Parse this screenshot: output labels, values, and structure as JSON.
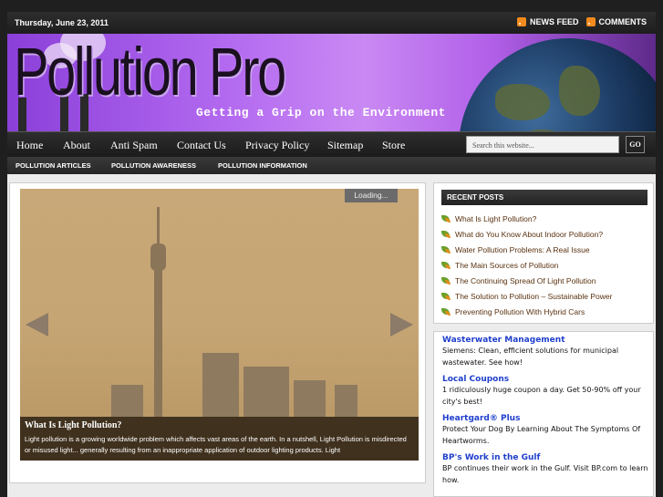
{
  "topbar": {
    "date": "Thursday, June 23, 2011",
    "links": [
      {
        "label": "NEWS FEED",
        "icon": "rss-icon"
      },
      {
        "label": "COMMENTS",
        "icon": "rss-icon"
      }
    ]
  },
  "header": {
    "title": "Pollution Pro",
    "tagline": "Getting a Grip on the Environment"
  },
  "nav": {
    "items": [
      "Home",
      "About",
      "Anti Spam",
      "Contact Us",
      "Privacy Policy",
      "Sitemap",
      "Store"
    ],
    "search_placeholder": "Search this website...",
    "go_label": "GO"
  },
  "subnav": {
    "items": [
      "POLLUTION ARTICLES",
      "POLLUTION AWARENESS",
      "POLLUTION INFORMATION"
    ]
  },
  "slider": {
    "loading": "Loading...",
    "caption_title": "What Is Light Pollution?",
    "caption_text": "Light pollution is a growing worldwide problem which affects vast areas of the earth. In a nutshell, Light Pollution is misdirected or misused light... generally resulting from an inappropriate application of outdoor lighting products. Light"
  },
  "recent_posts": {
    "title": "RECENT POSTS",
    "items": [
      "What Is Light Pollution?",
      "What do You Know About Indoor Pollution?",
      "Water Pollution Problems: A Real Issue",
      "The Main Sources of Pollution",
      "The Continuing Spread Of Light Pollution",
      "The Solution to Pollution – Sustainable Power",
      "Preventing Pollution With Hybrid Cars"
    ]
  },
  "ads": [
    {
      "title": "Wasterwater Management",
      "text": "Siemens: Clean, efficient solutions for municipal wastewater. See how!"
    },
    {
      "title": "Local Coupons",
      "text": "1 ridiculously huge coupon a day. Get 50-90% off your city's best!"
    },
    {
      "title": "Heartgard® Plus",
      "text": "Protect Your Dog By Learning About The Symptoms Of Heartworms."
    },
    {
      "title": "BP's Work in the Gulf",
      "text": "BP continues their work in the Gulf. Visit BP.com to learn how."
    }
  ]
}
